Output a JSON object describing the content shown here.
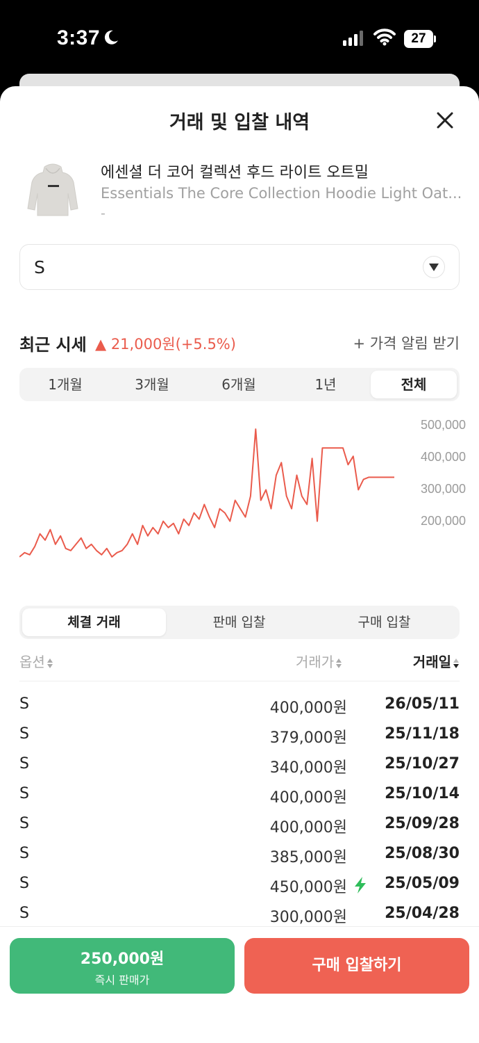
{
  "status_bar": {
    "time": "3:37",
    "battery": "27"
  },
  "sheet": {
    "title": "거래 및 입찰 내역",
    "close_icon": "close-icon"
  },
  "product": {
    "name_ko": "에센셜 더 코어 컬렉션 후드 라이트 오트밀",
    "name_en": "Essentials The Core Collection Hoodie Light Oat...",
    "sub": "-"
  },
  "size_select": {
    "value": "S"
  },
  "recent": {
    "label": "최근 시세",
    "change": "▲ 21,000원(+5.5%)",
    "alert_label": "+ 가격 알림 받기",
    "change_color": "#ea5b4c"
  },
  "period_tabs": [
    {
      "label": "1개월",
      "active": false
    },
    {
      "label": "3개월",
      "active": false
    },
    {
      "label": "6개월",
      "active": false
    },
    {
      "label": "1년",
      "active": false
    },
    {
      "label": "전체",
      "active": true
    }
  ],
  "chart_data": {
    "type": "line",
    "color": "#ea5b4c",
    "y_ticks": [
      "500,000",
      "400,000",
      "300,000",
      "200,000"
    ],
    "ylim": [
      130000,
      520000
    ],
    "series": [
      {
        "values": [
          185000,
          195000,
          190000,
          210000,
          240000,
          225000,
          250000,
          215000,
          235000,
          205000,
          200000,
          215000,
          230000,
          205000,
          215000,
          200000,
          190000,
          205000,
          185000,
          195000,
          200000,
          215000,
          240000,
          215000,
          260000,
          235000,
          255000,
          240000,
          270000,
          255000,
          265000,
          240000,
          275000,
          260000,
          290000,
          275000,
          310000,
          280000,
          255000,
          300000,
          290000,
          270000,
          320000,
          300000,
          280000,
          330000,
          490000,
          320000,
          345000,
          300000,
          380000,
          410000,
          330000,
          300000,
          380000,
          330000,
          310000,
          420000,
          270000,
          445000,
          445000,
          445000,
          445000,
          445000,
          405000,
          425000,
          345000,
          370000,
          375000,
          375000,
          375000,
          375000,
          375000,
          375000
        ]
      }
    ]
  },
  "trade_tabs": [
    {
      "label": "체결 거래",
      "active": true
    },
    {
      "label": "판매 입찰",
      "active": false
    },
    {
      "label": "구매 입찰",
      "active": false
    }
  ],
  "table": {
    "headers": {
      "option": "옵션",
      "price": "거래가",
      "date": "거래일"
    },
    "rows": [
      {
        "option": "S",
        "price": "400,000원",
        "date": "26/05/11",
        "fast": false
      },
      {
        "option": "S",
        "price": "379,000원",
        "date": "25/11/18",
        "fast": false
      },
      {
        "option": "S",
        "price": "340,000원",
        "date": "25/10/27",
        "fast": false
      },
      {
        "option": "S",
        "price": "400,000원",
        "date": "25/10/14",
        "fast": false
      },
      {
        "option": "S",
        "price": "400,000원",
        "date": "25/09/28",
        "fast": false
      },
      {
        "option": "S",
        "price": "385,000원",
        "date": "25/08/30",
        "fast": false
      },
      {
        "option": "S",
        "price": "450,000원",
        "date": "25/05/09",
        "fast": true
      },
      {
        "option": "S",
        "price": "300,000원",
        "date": "25/04/28",
        "fast": false
      }
    ]
  },
  "bottom": {
    "sell_price": "250,000원",
    "sell_caption": "즉시 판매가",
    "buy_label": "구매 입찰하기",
    "sell_color": "#41b979",
    "buy_color": "#ef6253"
  }
}
